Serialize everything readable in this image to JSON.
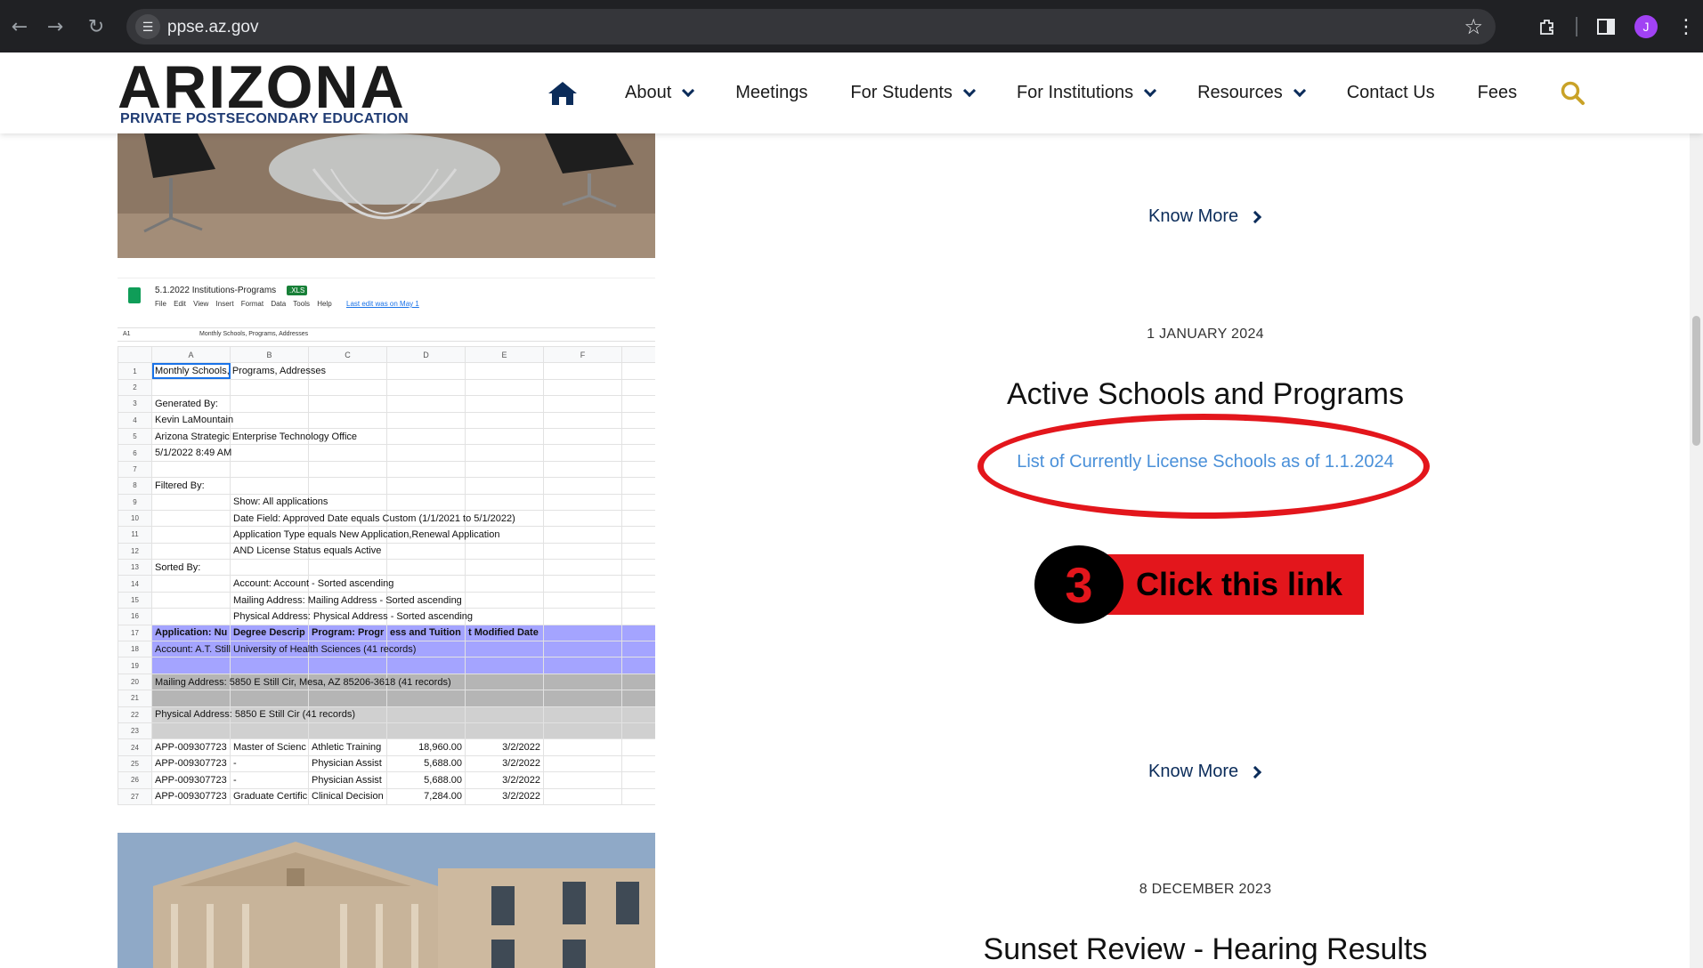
{
  "browser": {
    "url": "ppse.az.gov",
    "avatar_letter": "J"
  },
  "site": {
    "logo_word": "ARIZONA",
    "logo_sub": "PRIVATE POSTSECONDARY EDUCATION",
    "nav": [
      {
        "label": "About",
        "dropdown": true
      },
      {
        "label": "Meetings",
        "dropdown": false
      },
      {
        "label": "For Students",
        "dropdown": true
      },
      {
        "label": "For Institutions",
        "dropdown": true
      },
      {
        "label": "Resources",
        "dropdown": true
      },
      {
        "label": "Contact Us",
        "dropdown": false
      },
      {
        "label": "Fees",
        "dropdown": false
      }
    ]
  },
  "posts": {
    "know_more_1": "Know More",
    "post1_date": "1 JANUARY 2024",
    "post1_title": "Active Schools and Programs",
    "post1_link": "List of Currently License Schools as of 1.1.2024",
    "know_more_2": "Know More",
    "post2_date": "8 DECEMBER 2023",
    "post2_title": "Sunset Review - Hearing Results"
  },
  "annotation": {
    "step_number": "3",
    "text": "Click this link",
    "color": "#e3161c"
  },
  "spreadsheet": {
    "title": "5.1.2022 Institutions-Programs",
    "badge": ".XLS",
    "menu": "File Edit View Insert Format Data Tools Help",
    "last_edit": "Last edit was on May 1",
    "cell_ref": "A1",
    "formula": "Monthly Schools, Programs, Addresses",
    "columns": [
      "A",
      "B",
      "C",
      "D",
      "E",
      "F"
    ],
    "rows": [
      {
        "n": "1",
        "a": "Monthly Schools, Programs, Addresses"
      },
      {
        "n": "2",
        "a": ""
      },
      {
        "n": "3",
        "a": "Generated By:"
      },
      {
        "n": "4",
        "a": "Kevin LaMountain"
      },
      {
        "n": "5",
        "a": "Arizona Strategic Enterprise Technology Office"
      },
      {
        "n": "6",
        "a": "5/1/2022 8:49 AM"
      },
      {
        "n": "7",
        "a": ""
      },
      {
        "n": "8",
        "a": "Filtered By:"
      },
      {
        "n": "9",
        "b": "Show: All applications"
      },
      {
        "n": "10",
        "b": "Date Field: Approved Date equals Custom (1/1/2021 to 5/1/2022)"
      },
      {
        "n": "11",
        "b": "Application Type equals New Application,Renewal Application"
      },
      {
        "n": "12",
        "b": "AND License Status equals Active"
      },
      {
        "n": "13",
        "a": "Sorted By:"
      },
      {
        "n": "14",
        "b": "Account: Account - Sorted ascending"
      },
      {
        "n": "15",
        "b": "Mailing Address: Mailing Address - Sorted ascending"
      },
      {
        "n": "16",
        "b": "Physical Address: Physical Address - Sorted ascending"
      },
      {
        "n": "17",
        "a": "Application: Nu",
        "b": "Degree Descrip",
        "c": "Program: Progr",
        "d": "ess and Tuition",
        "e": "t Modified Date"
      },
      {
        "n": "18",
        "a": "Account: A.T. Still University of Health Sciences (41 records)"
      },
      {
        "n": "19",
        "a": ""
      },
      {
        "n": "20",
        "a": "Mailing Address: 5850 E Still Cir, Mesa, AZ 85206-3618 (41 records)"
      },
      {
        "n": "21",
        "a": ""
      },
      {
        "n": "22",
        "a": "Physical Address: 5850 E Still Cir (41 records)"
      },
      {
        "n": "23",
        "a": ""
      },
      {
        "n": "24",
        "a": "APP-009307723",
        "b": "Master of Scienc",
        "c": "Athletic Training",
        "d": "18,960.00",
        "e": "3/2/2022"
      },
      {
        "n": "25",
        "a": "APP-009307723",
        "b": "-",
        "c": "Physician Assist",
        "d": "5,688.00",
        "e": "3/2/2022"
      },
      {
        "n": "26",
        "a": "APP-009307723",
        "b": "-",
        "c": "Physician Assist",
        "d": "5,688.00",
        "e": "3/2/2022"
      },
      {
        "n": "27",
        "a": "APP-009307723",
        "b": "Graduate Certific",
        "c": "Clinical Decision",
        "d": "7,284.00",
        "e": "3/2/2022"
      }
    ]
  }
}
